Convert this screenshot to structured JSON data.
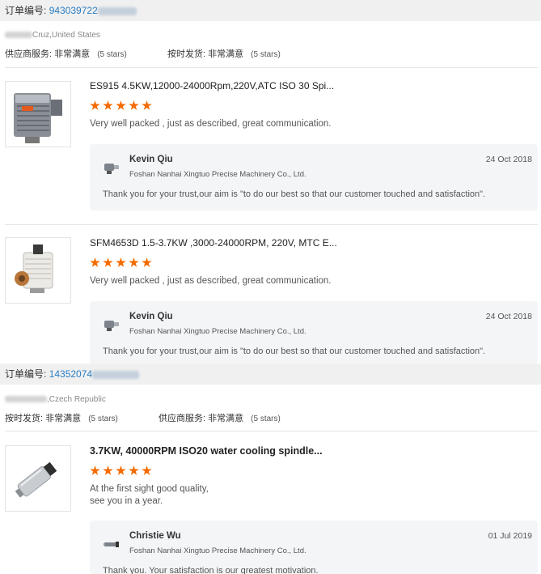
{
  "orders": [
    {
      "order_label": "订单编号:",
      "order_number": "943039722",
      "buyer_location": "Cruz,United States",
      "rating_1_label": "供应商服务:",
      "rating_1_value": "非常满意",
      "rating_1_stars": "(5 stars)",
      "rating_2_label": "按时发货:",
      "rating_2_value": "非常满意",
      "rating_2_stars": "(5 stars)",
      "items": [
        {
          "title": "ES915 4.5KW,12000-24000Rpm,220V,ATC ISO 30 Spi...",
          "stars": 5,
          "feedback": "Very well packed , just as described, great communication.",
          "reply": {
            "name": "Kevin Qiu",
            "company": "Foshan Nanhai Xingtuo Precise Machinery Co., Ltd.",
            "date": "24 Oct 2018",
            "message": "Thank you for your trust,our aim is \"to do our best so that our customer touched and satisfaction\"."
          }
        },
        {
          "title": "SFM4653D 1.5-3.7KW ,3000-24000RPM, 220V, MTC E...",
          "stars": 5,
          "feedback": "Very well packed , just as described, great communication.",
          "reply": {
            "name": "Kevin Qiu",
            "company": "Foshan Nanhai Xingtuo Precise Machinery Co., Ltd.",
            "date": "24 Oct 2018",
            "message": "Thank you for your trust,our aim is \"to do our best so that our customer touched and satisfaction\"."
          }
        }
      ]
    },
    {
      "order_label": "订单编号:",
      "order_number": "14352074",
      "buyer_location": ",Czech Republic",
      "rating_1_label": "按时发货:",
      "rating_1_value": "非常满意",
      "rating_1_stars": "(5 stars)",
      "rating_2_label": "供应商服务:",
      "rating_2_value": "非常满意",
      "rating_2_stars": "(5 stars)",
      "items": [
        {
          "title": "3.7KW, 40000RPM ISO20 water cooling spindle...",
          "stars": 5,
          "feedback_line1": "At the first sight good quality,",
          "feedback_line2": "see you in a year.",
          "reply": {
            "name": "Christie Wu",
            "company": "Foshan Nanhai Xingtuo Precise Machinery Co., Ltd.",
            "date": "01 Jul 2019",
            "message": "Thank you. Your satisfaction is our greatest motivation."
          }
        }
      ]
    }
  ],
  "colors": {
    "accent_link": "#2a7dc4",
    "star": "#f56a00",
    "reply_bg": "#f4f5f7",
    "order_bar_bg": "#f0f0f0"
  }
}
